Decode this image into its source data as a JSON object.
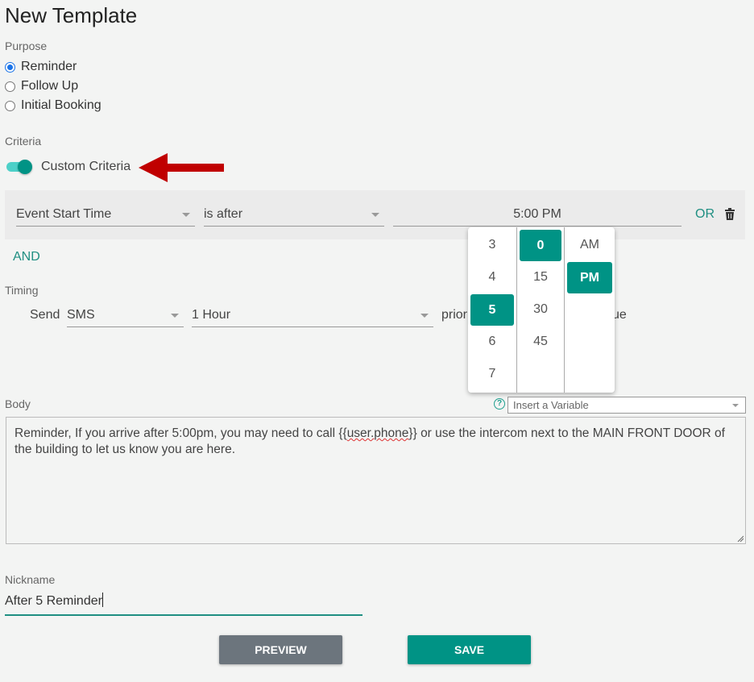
{
  "page": {
    "title": "New Template"
  },
  "purpose": {
    "label": "Purpose",
    "options": [
      {
        "label": "Reminder",
        "checked": true
      },
      {
        "label": "Follow Up",
        "checked": false
      },
      {
        "label": "Initial Booking",
        "checked": false
      }
    ]
  },
  "criteria": {
    "label": "Criteria",
    "toggle_label": "Custom Criteria",
    "toggle_on": true,
    "rule": {
      "field": "Event Start Time",
      "operator": "is after",
      "value": "5:00 PM",
      "or_label": "OR"
    },
    "and_label": "AND"
  },
  "time_picker": {
    "hours": [
      "3",
      "4",
      "5",
      "6",
      "7"
    ],
    "selected_hour": "5",
    "minutes": [
      "0",
      "15",
      "30",
      "45"
    ],
    "selected_minute": "0",
    "periods": [
      "AM",
      "PM"
    ],
    "selected_period": "PM"
  },
  "timing": {
    "label": "Timing",
    "send_label": "Send",
    "channel": "SMS",
    "offset": "1 Hour",
    "prior_text": "prior",
    "trailing_text": "ue"
  },
  "body": {
    "label": "Body",
    "variable_placeholder": "Insert a Variable",
    "text_before": "Reminder, If you arrive after 5:00pm, you may need to call {{",
    "text_var": "user.phone",
    "text_after": "}} or use the intercom next to the MAIN FRONT DOOR of the building to let us know you are here."
  },
  "nickname": {
    "label": "Nickname",
    "value": "After 5 Reminder"
  },
  "buttons": {
    "preview": "PREVIEW",
    "save": "SAVE"
  },
  "colors": {
    "accent": "#009385",
    "arrow": "#c00000",
    "preview_button": "#6c757d",
    "radio": "#1a73e8"
  }
}
